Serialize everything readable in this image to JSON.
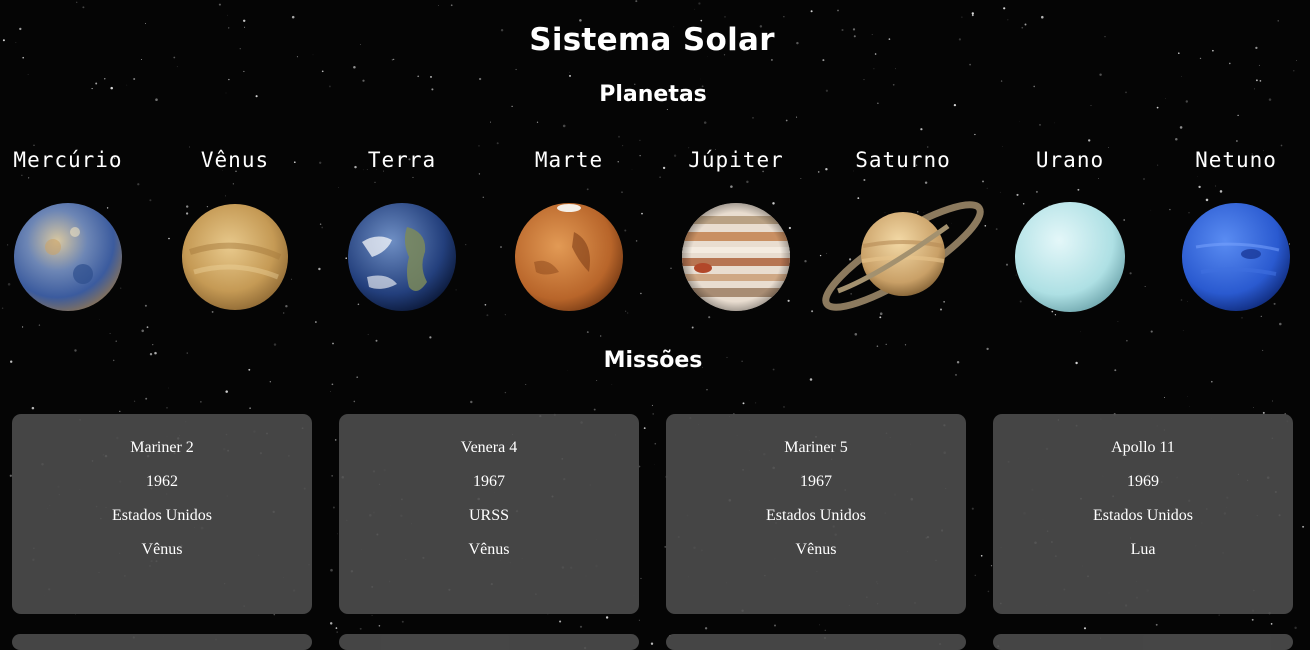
{
  "header": {
    "title": "Sistema Solar"
  },
  "planets_section": {
    "heading": "Planetas",
    "items": [
      {
        "name": "Mercúrio",
        "icon": "mercury-icon"
      },
      {
        "name": "Vênus",
        "icon": "venus-icon"
      },
      {
        "name": "Terra",
        "icon": "earth-icon"
      },
      {
        "name": "Marte",
        "icon": "mars-icon"
      },
      {
        "name": "Júpiter",
        "icon": "jupiter-icon"
      },
      {
        "name": "Saturno",
        "icon": "saturn-icon"
      },
      {
        "name": "Urano",
        "icon": "uranus-icon"
      },
      {
        "name": "Netuno",
        "icon": "neptune-icon"
      }
    ]
  },
  "missions_section": {
    "heading": "Missões",
    "cards": [
      {
        "name": "Mariner 2",
        "year": "1962",
        "country": "Estados Unidos",
        "target": "Vênus"
      },
      {
        "name": "Venera 4",
        "year": "1967",
        "country": "URSS",
        "target": "Vênus"
      },
      {
        "name": "Mariner 5",
        "year": "1967",
        "country": "Estados Unidos",
        "target": "Vênus"
      },
      {
        "name": "Apollo 11",
        "year": "1969",
        "country": "Estados Unidos",
        "target": "Lua"
      }
    ]
  },
  "colors": {
    "background": "#050505",
    "card": "#4b4b4b",
    "text": "#ffffff"
  }
}
